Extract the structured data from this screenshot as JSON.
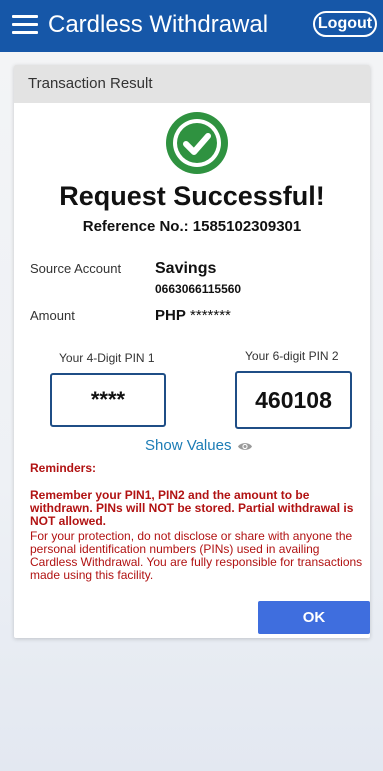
{
  "header": {
    "title": "Cardless Withdrawal",
    "logout_label": "Logout"
  },
  "card": {
    "section_title": "Transaction Result",
    "headline": "Request Successful!",
    "reference": "Reference No.: 1585102309301",
    "source_account_label": "Source Account",
    "account_type": "Savings",
    "account_number": "0663066115560",
    "amount_label": "Amount",
    "amount_currency": "PHP",
    "amount_masked": "*******",
    "pin1_label": "Your 4-Digit PIN 1",
    "pin1_value": "****",
    "pin2_label": "Your 6-digit PIN 2",
    "pin2_value": "460108",
    "show_values_label": "Show Values",
    "reminders_title": "Reminders:",
    "reminders_bold": "Remember your PIN1, PIN2 and the amount to be withdrawn. PINs will NOT be stored. Partial withdrawal is NOT allowed.",
    "reminders_text": "For your protection, do not disclose or share with anyone the personal identification numbers (PINs) used in availing Cardless Withdrawal. You are fully responsible for transactions made using this facility.",
    "ok_label": "OK"
  },
  "colors": {
    "header_bg": "#1657a8",
    "success_green": "#2f9240",
    "reminder_red": "#b11212",
    "ok_button": "#3f6ede",
    "link_blue": "#1c7cb5"
  },
  "icons": [
    "menu-icon",
    "success-check-icon",
    "eye-icon"
  ]
}
